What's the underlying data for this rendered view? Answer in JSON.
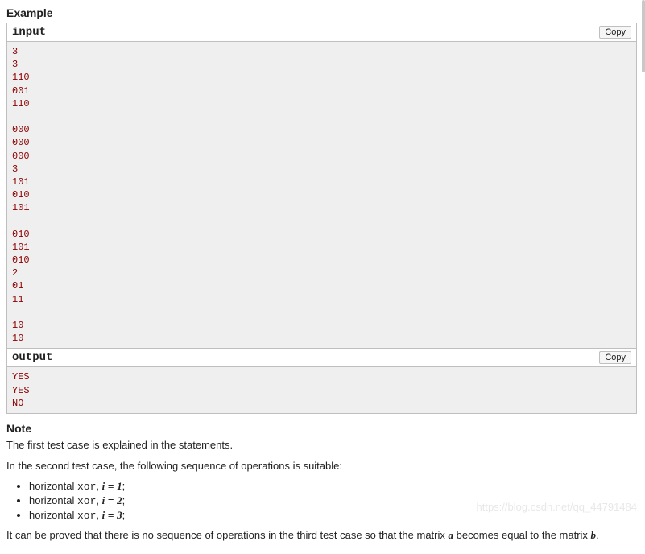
{
  "example_heading": "Example",
  "input": {
    "title": "input",
    "copy_label": "Copy",
    "content": "3\n3\n110\n001\n110\n\n000\n000\n000\n3\n101\n010\n101\n\n010\n101\n010\n2\n01\n11\n\n10\n10"
  },
  "output": {
    "title": "output",
    "copy_label": "Copy",
    "content": "YES\nYES\nNO"
  },
  "note": {
    "heading": "Note",
    "p1": "The first test case is explained in the statements.",
    "p2": "In the second test case, the following sequence of operations is suitable:",
    "bullets": {
      "b1": {
        "prefix": "horizontal ",
        "op": "xor",
        "sep": ", ",
        "var": "i",
        "eq": " = ",
        "val": "1",
        "suf": ";"
      },
      "b2": {
        "prefix": "horizontal ",
        "op": "xor",
        "sep": ", ",
        "var": "i",
        "eq": " = ",
        "val": "2",
        "suf": ";"
      },
      "b3": {
        "prefix": "horizontal ",
        "op": "xor",
        "sep": ", ",
        "var": "i",
        "eq": " = ",
        "val": "3",
        "suf": ";"
      }
    },
    "p3_1": "It can be proved that there is no sequence of operations in the third test case so that the matrix ",
    "p3_a": "a",
    "p3_2": " becomes equal to the matrix ",
    "p3_b": "b",
    "p3_3": "."
  },
  "watermark": "https://blog.csdn.net/qq_44791484"
}
